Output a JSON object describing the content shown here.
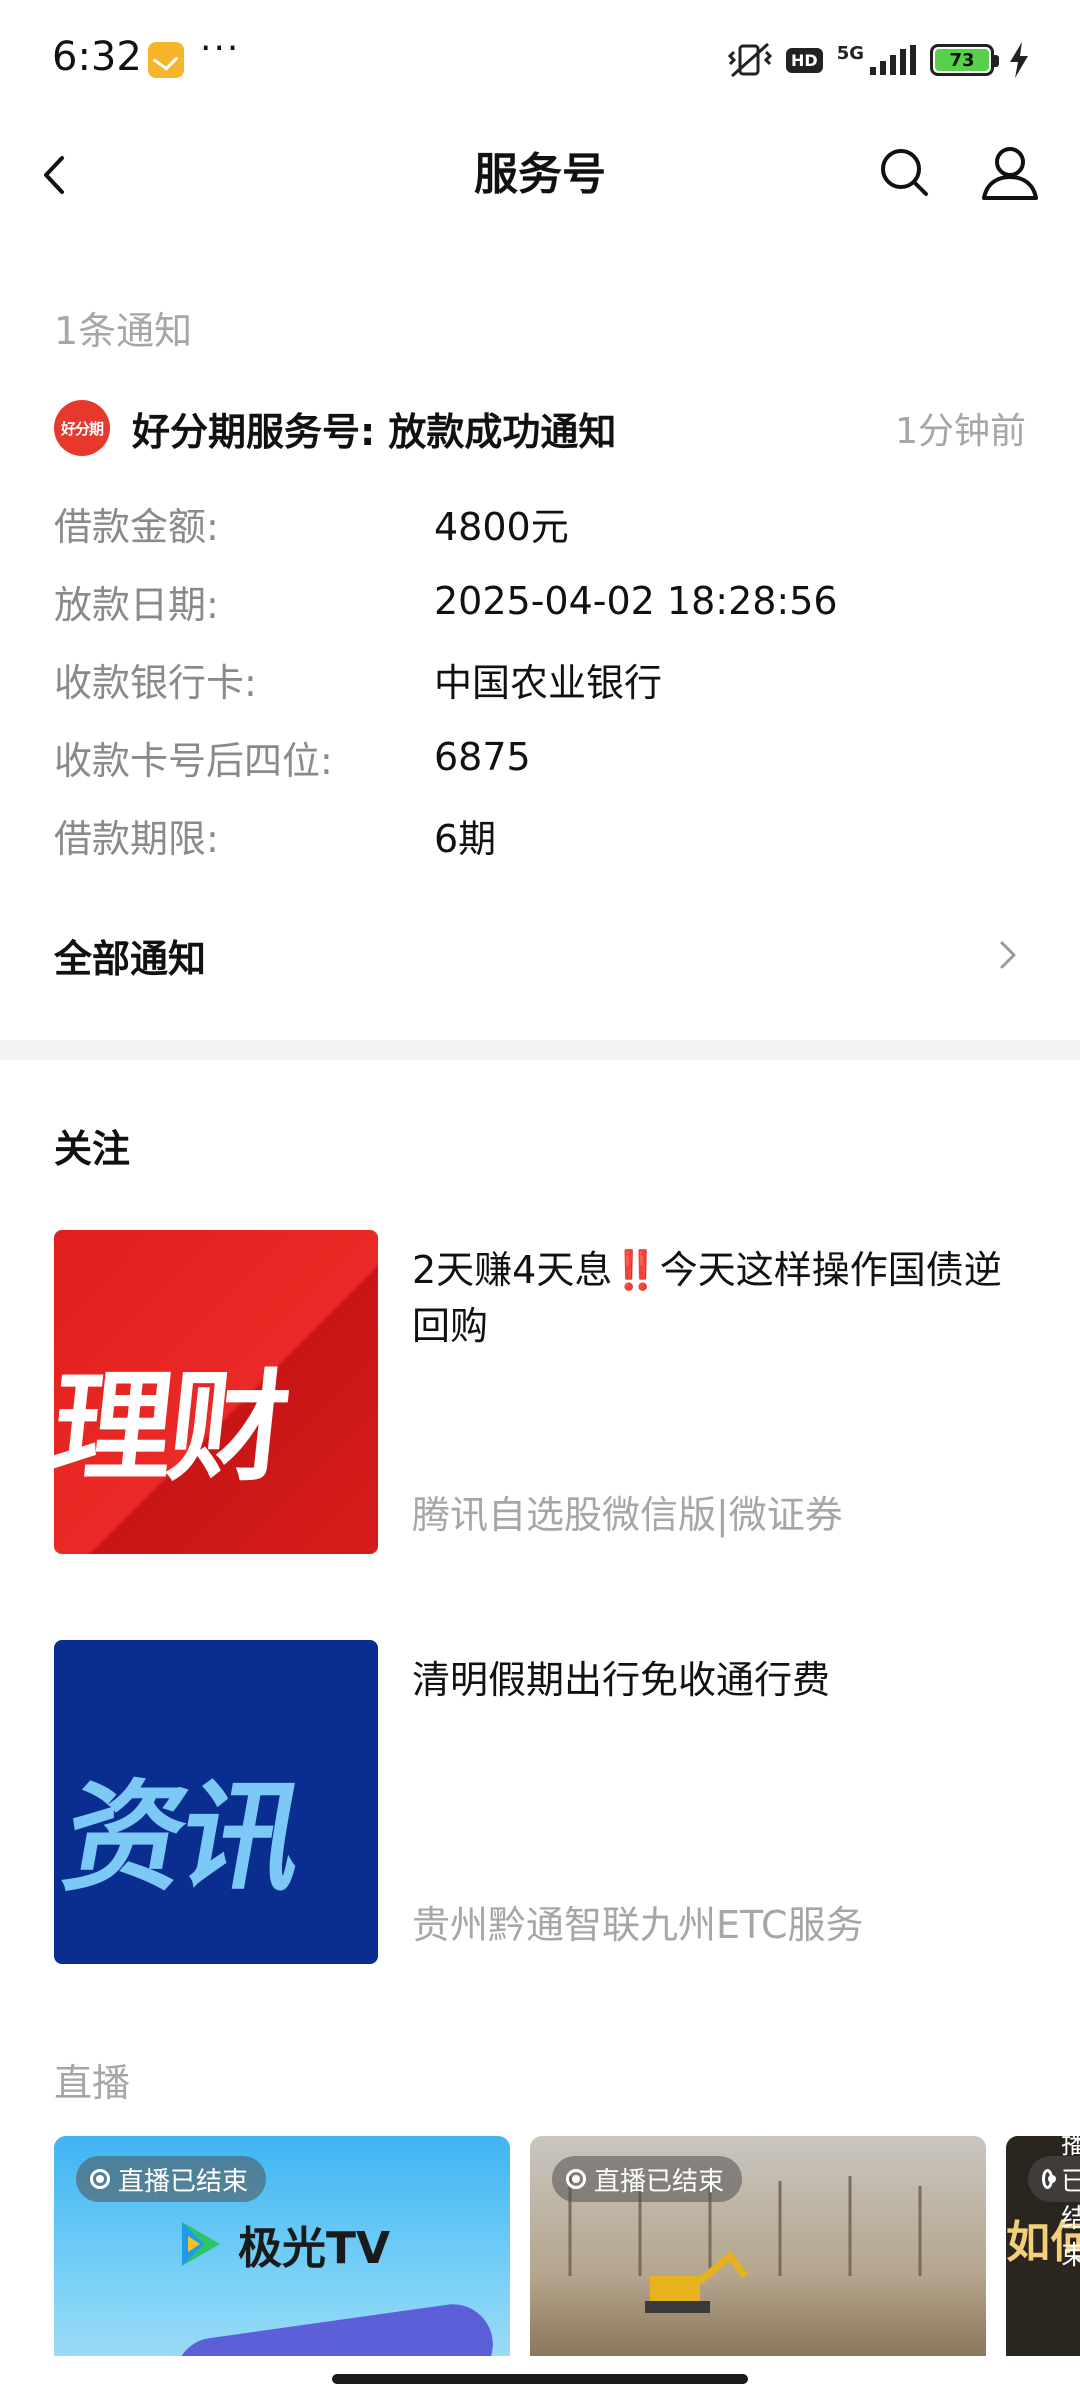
{
  "status_bar": {
    "time": "6:32",
    "more": "···",
    "hd": "HD",
    "network": "5G",
    "battery": "73"
  },
  "nav": {
    "title": "服务号",
    "icons": [
      "back-arrow-icon",
      "search-icon",
      "profile-icon"
    ]
  },
  "notification": {
    "count_label": "1条通知",
    "logo_text": "好分期",
    "title": "好分期服务号:  放款成功通知",
    "time": "1分钟前",
    "fields": [
      {
        "label": "借款金额:",
        "value": "4800元"
      },
      {
        "label": "放款日期:",
        "value": "2025-04-02 18:28:56"
      },
      {
        "label": "收款银行卡:",
        "value": "中国农业银行"
      },
      {
        "label": "收款卡号后四位:",
        "value": "6875"
      },
      {
        "label": "借款期限:",
        "value": "6期"
      }
    ],
    "all_label": "全部通知"
  },
  "follow": {
    "section_title": "关注",
    "articles": [
      {
        "thumb_text": "理财",
        "title_a": "2天赚4天息",
        "title_bang": "‼️",
        "title_b": "今天这样操作国债逆回购",
        "source": "腾讯自选股微信版|微证券"
      },
      {
        "thumb_text": "资讯",
        "title_a": "清明假期出行免收通行费",
        "title_bang": "",
        "title_b": "",
        "source": "贵州黔通智联九州ETC服务"
      }
    ]
  },
  "live": {
    "section_title": "直播",
    "cards": [
      {
        "badge": "直播已结束",
        "logo_text": "极光TV"
      },
      {
        "badge": "直播已结束"
      },
      {
        "badge": "直播已结束",
        "text": "如何"
      }
    ]
  },
  "colors": {
    "brand_red": "#e8372b",
    "muted_text": "#a6a6a6",
    "thumb_red": "#e21d1d",
    "thumb_blue": "#0a2d90"
  }
}
